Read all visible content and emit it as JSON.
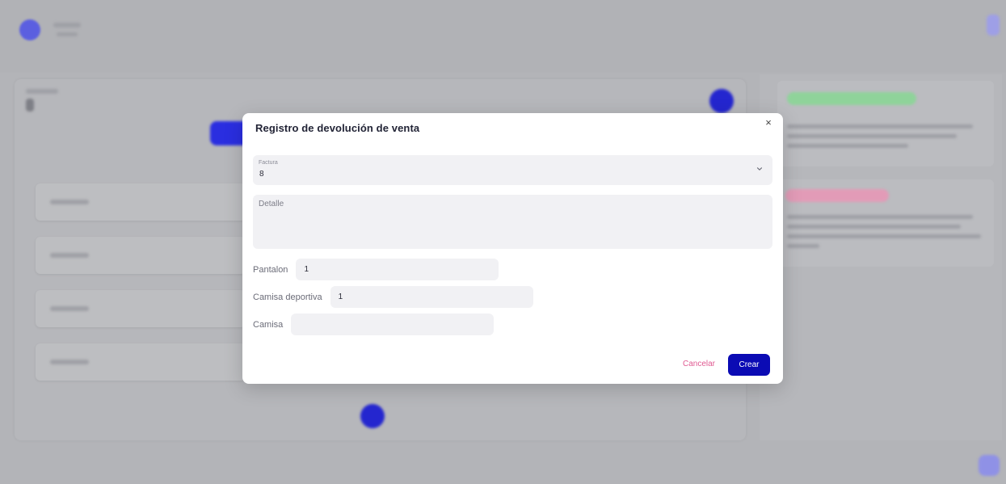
{
  "modal": {
    "title": "Registro de devolución de venta",
    "close_icon": "×",
    "invoice": {
      "label": "Factura",
      "value": "8"
    },
    "detail": {
      "placeholder": "Detalle",
      "value": ""
    },
    "products": [
      {
        "label": "Pantalon",
        "value": "1"
      },
      {
        "label": "Camisa deportiva",
        "value": "1"
      },
      {
        "label": "Camisa",
        "value": ""
      }
    ],
    "cancel_label": "Cancelar",
    "create_label": "Crear"
  },
  "colors": {
    "overlay": "#b3b4b8",
    "accent": "#0b0bb4",
    "cancel": "#e05a92",
    "field_bg": "#f1f1f4"
  },
  "icons": {
    "close": "close-icon",
    "dropdown": "chevron-down-icon"
  }
}
